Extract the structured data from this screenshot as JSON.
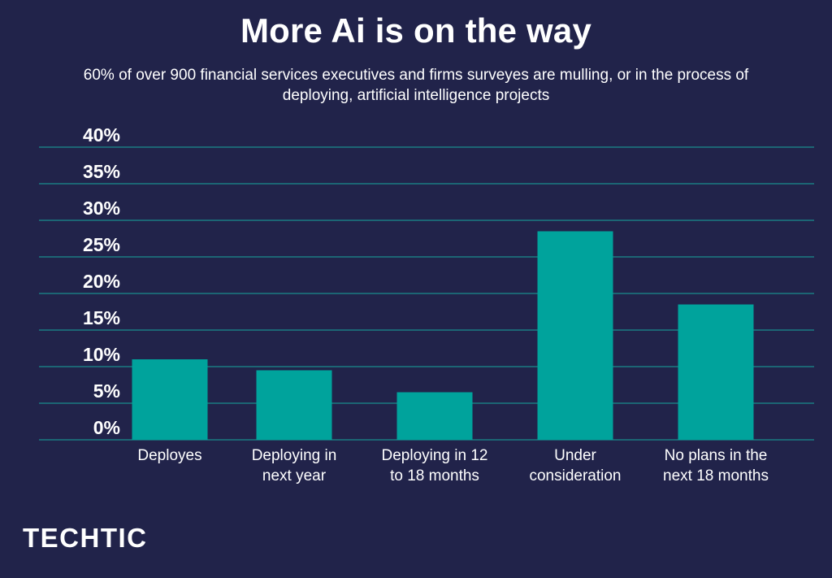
{
  "brand": {
    "logo_text": "TECHTIC",
    "background_color": "#21234a",
    "bar_color": "#00a39c",
    "grid_color": "#17a79e"
  },
  "chart_data": {
    "type": "bar",
    "title": "More Ai is on the way",
    "subtitle": "60% of over 900 financial services executives and firms surveyes are mulling, or in the process of deploying, artificial intelligence projects",
    "xlabel": "",
    "ylabel": "",
    "categories": [
      [
        "Deployes"
      ],
      [
        "Deploying in",
        "next year"
      ],
      [
        "Deploying in 12",
        "to 18 months"
      ],
      [
        "Under",
        "consideration"
      ],
      [
        "No plans in the",
        "next 18 months"
      ]
    ],
    "values": [
      11,
      9.5,
      6.5,
      28.5,
      18.5
    ],
    "ylim": [
      0,
      40
    ],
    "yticks": [
      "0%",
      "5%",
      "10%",
      "15%",
      "20%",
      "25%",
      "30%",
      "35%",
      "40%"
    ],
    "grid": true,
    "legend": "none"
  }
}
